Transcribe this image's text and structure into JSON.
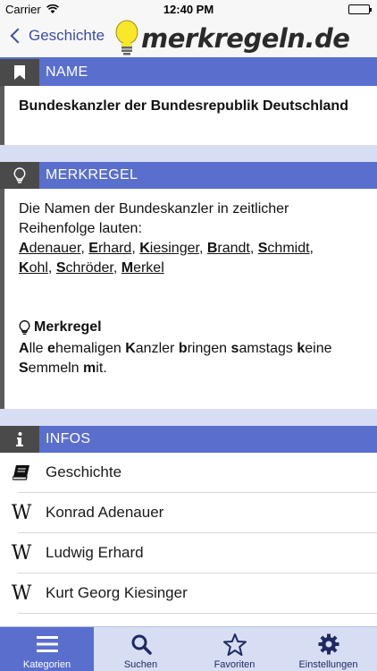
{
  "status": {
    "carrier": "Carrier",
    "time": "12:40 PM"
  },
  "nav": {
    "back_label": "Geschichte",
    "logo_text": "merkregeln.de"
  },
  "sections": {
    "name": {
      "title": "NAME",
      "text": "Bundeskanzler der Bundesrepublik Deutschland"
    },
    "rule": {
      "title": "MERKREGEL",
      "intro": "Die Namen der Bundeskanzler in zeitlicher Reihenfolge lauten:",
      "names": [
        "Adenauer",
        "Erhard",
        "Kiesinger",
        "Brandt",
        "Schmidt",
        "Kohl",
        "Schröder",
        "Merkel"
      ],
      "mnemonic_heading": "Merkregel",
      "mnemonic_words": [
        "Alle",
        "ehemaligen",
        "Kanzler",
        "bringen",
        "samstags",
        "keine",
        "Semmeln",
        "mit."
      ]
    },
    "infos": {
      "title": "INFOS",
      "items": [
        {
          "icon": "book-icon",
          "label": "Geschichte"
        },
        {
          "icon": "wikipedia-icon",
          "label": "Konrad Adenauer"
        },
        {
          "icon": "wikipedia-icon",
          "label": "Ludwig Erhard"
        },
        {
          "icon": "wikipedia-icon",
          "label": "Kurt Georg Kiesinger"
        }
      ]
    }
  },
  "tabs": [
    {
      "label": "Kategorien",
      "icon": "menu-icon",
      "active": true
    },
    {
      "label": "Suchen",
      "icon": "search-icon",
      "active": false
    },
    {
      "label": "Favoriten",
      "icon": "star-icon",
      "active": false
    },
    {
      "label": "Einstellungen",
      "icon": "gear-icon",
      "active": false
    }
  ],
  "colors": {
    "accent": "#5a6ecd",
    "dark": "#4a4a4a",
    "background": "#d7def4",
    "link": "#3a4ca8"
  }
}
